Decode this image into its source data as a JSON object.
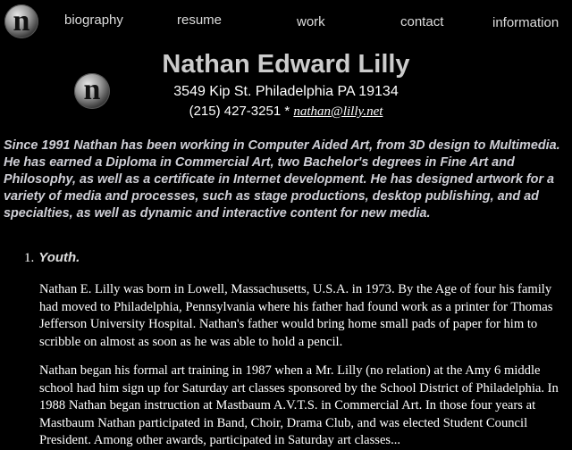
{
  "nav": {
    "logo_letter": "n",
    "items": [
      "biography",
      "resume",
      "work",
      "contact",
      "information"
    ]
  },
  "header": {
    "logo_letter": "n",
    "name": "Nathan Edward Lilly",
    "address": "3549 Kip St. Philadelphia PA 19134",
    "phone": "(215) 427-3251 *",
    "email": "nathan@lilly.net"
  },
  "intro": "Since 1991 Nathan has been working in Computer Aided Art, from 3D design to Multimedia. He has earned a Diploma in Commercial Art, two Bachelor's degrees in Fine Art and Philosophy, as well as a certificate in Internet development. He has designed artwork for a variety of media and processes, such as stage productions, desktop publishing, and ad specialties, as well as dynamic and interactive content for new media.",
  "section": {
    "number": "1.",
    "title": "Youth."
  },
  "paragraphs": [
    "Nathan E. Lilly was born in Lowell, Massachusetts, U.S.A. in 1973. By the Age of four his family had moved to Philadelphia, Pennsylvania where his father had found work as a printer for Thomas Jefferson University Hospital. Nathan's father would bring home small pads of paper for him to scribble on almost as soon as he was able to hold a pencil.",
    "Nathan began his formal art training in 1987 when a Mr. Lilly (no relation) at the Amy 6 middle school had him sign up for Saturday art classes sponsored by the School District of Philadelphia. In 1988 Nathan began instruction at Mastbaum A.V.T.S. in Commercial Art. In those four years at Mastbaum Nathan participated in Band, Choir, Drama Club, and was elected Student Council President. Among other awards, participated in Saturday art classes..."
  ],
  "colors": {
    "background": "#000000",
    "intro_text": "#cfcfd6",
    "name_text": "#cccccc"
  }
}
